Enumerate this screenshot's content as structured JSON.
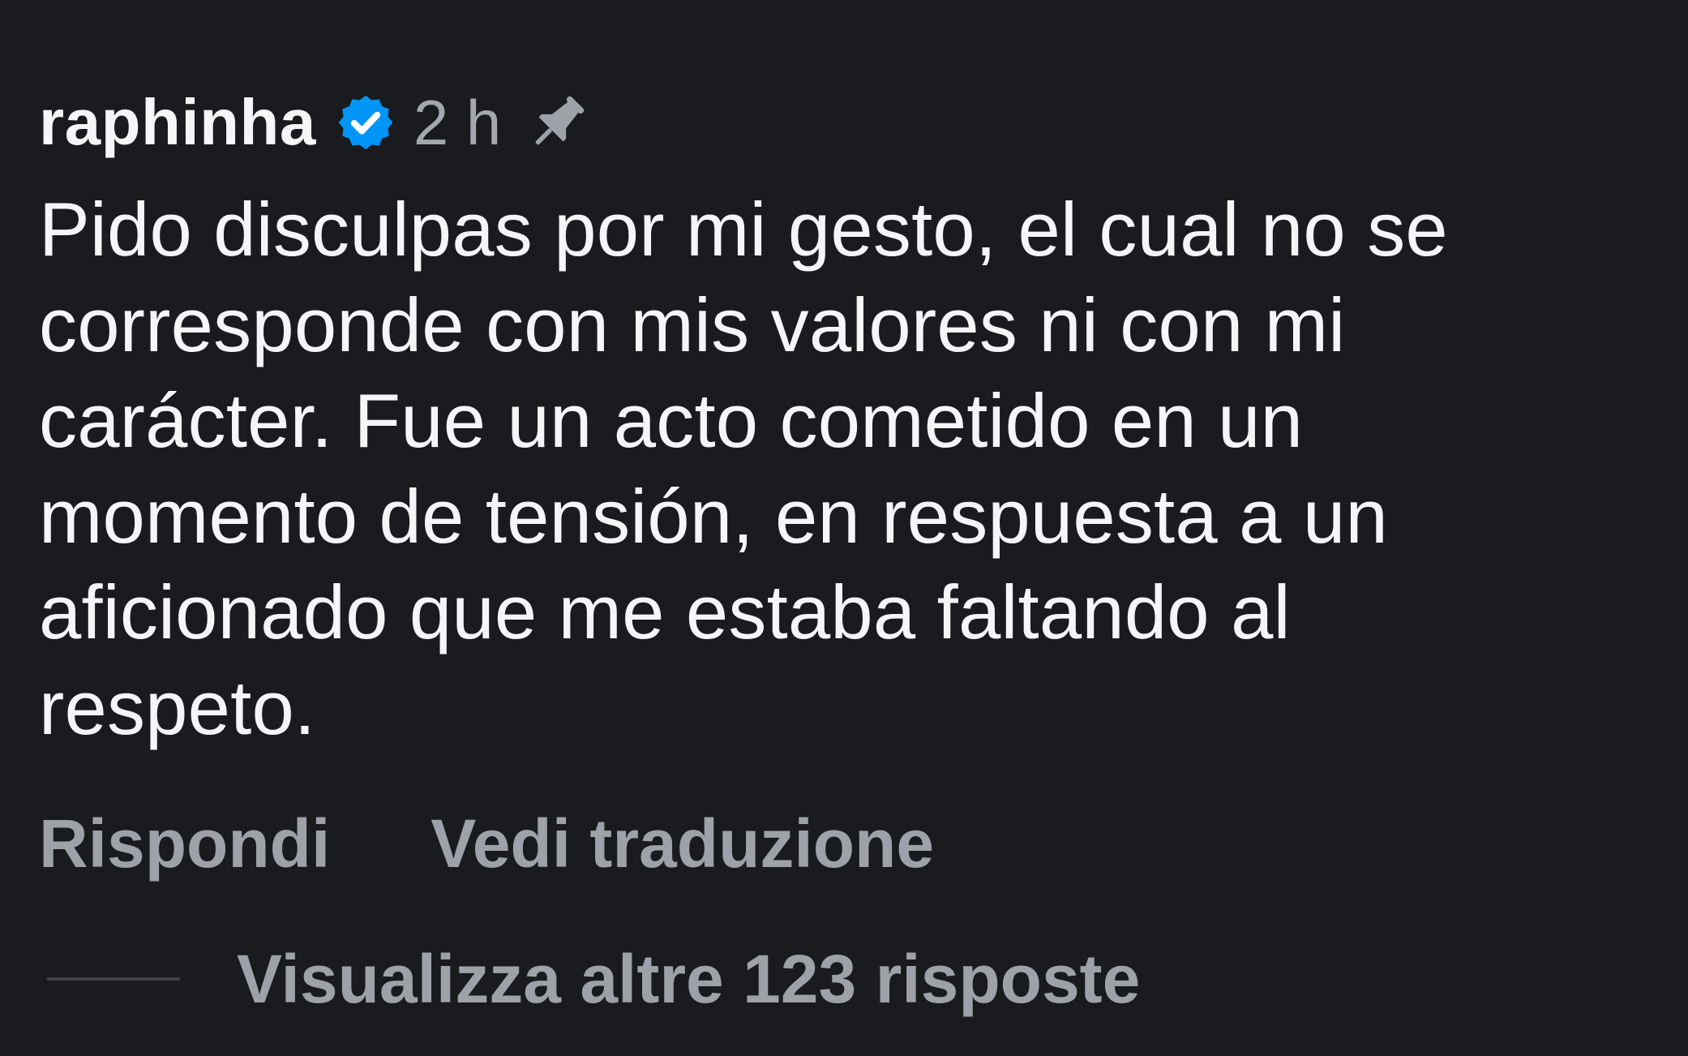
{
  "comment": {
    "username": "raphinha",
    "verified_icon": "verified-badge-icon",
    "timestamp": "2 h",
    "pin_icon": "pin-icon",
    "text_lines": [
      "Pido disculpas por mi gesto, el cual no se",
      "corresponde con mis valores ni con mi",
      "carácter. Fue un acto cometido en un",
      "momento de tensión, en respuesta a un",
      "aficionado que me estaba faltando al",
      "respeto."
    ],
    "actions": {
      "reply_label": "Rispondi",
      "translate_label": "Vedi traduzione"
    },
    "replies": {
      "label": "Visualizza altre 123 risposte"
    }
  },
  "colors": {
    "background": "#191b1f",
    "text_primary": "#f4f5f7",
    "text_secondary": "#9ea1a8",
    "verified_blue": "#0095f6"
  }
}
